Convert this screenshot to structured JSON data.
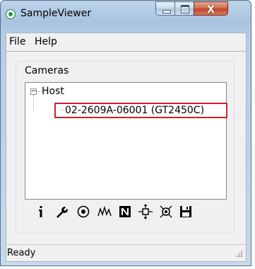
{
  "window": {
    "title": "SampleViewer",
    "controls": [
      "minimize",
      "maximize",
      "close"
    ],
    "close_glyph": "X"
  },
  "menu": {
    "items": [
      {
        "label": "File"
      },
      {
        "label": "Help"
      }
    ]
  },
  "cameras_group": {
    "label": "Cameras",
    "tree": {
      "expander_glyph": "−",
      "root": "Host",
      "children": [
        "02-2609A-06001 (GT2450C)"
      ]
    }
  },
  "toolbar": {
    "buttons": [
      {
        "icon": "info-icon",
        "glyph": "i"
      },
      {
        "icon": "wrench-icon"
      },
      {
        "icon": "eye-icon"
      },
      {
        "icon": "waveform-icon"
      },
      {
        "icon": "reset-icon"
      },
      {
        "icon": "focus-icon"
      },
      {
        "icon": "capture-icon"
      },
      {
        "icon": "save-icon"
      }
    ]
  },
  "status": {
    "text": "Ready"
  },
  "colors": {
    "selection_outline": "#d0202a",
    "close_button": "#c2432a",
    "frame": "#b5cde6"
  }
}
